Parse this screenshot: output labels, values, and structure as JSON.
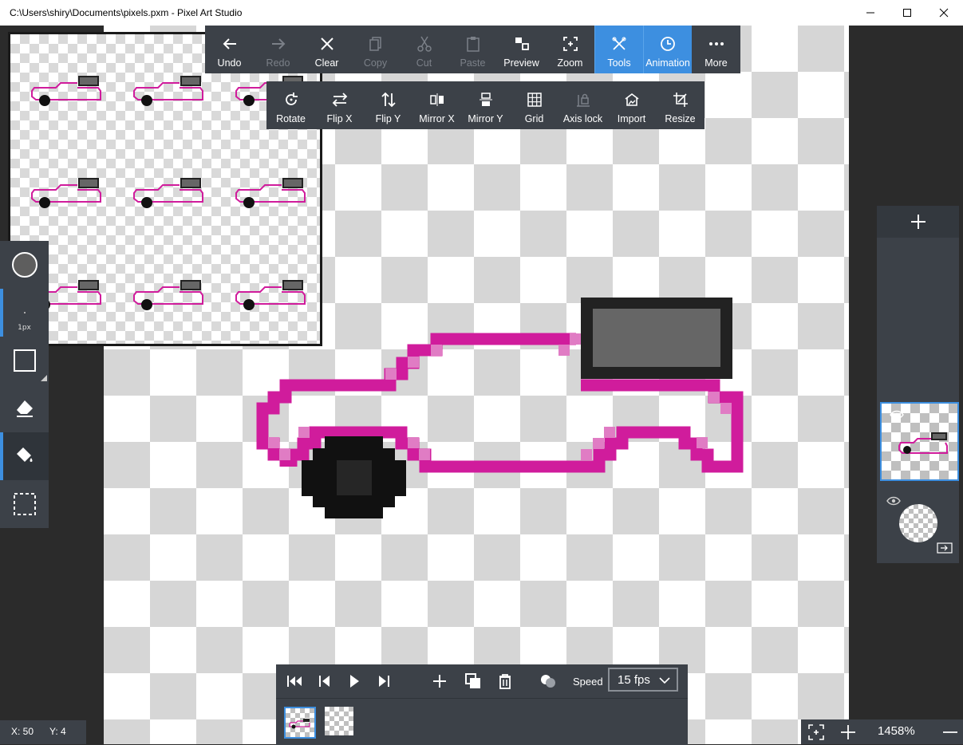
{
  "window": {
    "title": "C:\\Users\\shiry\\Documents\\pixels.pxm - Pixel Art Studio"
  },
  "toolbar_main": [
    {
      "label": "Undo",
      "icon": "arrow-left-icon",
      "state": "enabled"
    },
    {
      "label": "Redo",
      "icon": "arrow-right-icon",
      "state": "disabled"
    },
    {
      "label": "Clear",
      "icon": "close-icon",
      "state": "enabled"
    },
    {
      "label": "Copy",
      "icon": "copy-icon",
      "state": "disabled"
    },
    {
      "label": "Cut",
      "icon": "scissors-icon",
      "state": "disabled"
    },
    {
      "label": "Paste",
      "icon": "paste-icon",
      "state": "disabled"
    },
    {
      "label": "Preview",
      "icon": "preview-icon",
      "state": "enabled"
    },
    {
      "label": "Zoom",
      "icon": "zoom-icon",
      "state": "enabled"
    },
    {
      "label": "Tools",
      "icon": "tools-icon",
      "state": "active"
    },
    {
      "label": "Animation",
      "icon": "clock-icon",
      "state": "active"
    },
    {
      "label": "More",
      "icon": "more-icon",
      "state": "enabled"
    }
  ],
  "toolbar_tools": [
    {
      "label": "Rotate",
      "icon": "rotate-icon"
    },
    {
      "label": "Flip X",
      "icon": "flip-x-icon"
    },
    {
      "label": "Flip Y",
      "icon": "flip-y-icon"
    },
    {
      "label": "Mirror X",
      "icon": "mirror-x-icon"
    },
    {
      "label": "Mirror Y",
      "icon": "mirror-y-icon"
    },
    {
      "label": "Grid",
      "icon": "grid-icon"
    },
    {
      "label": "Axis lock",
      "icon": "axis-lock-icon"
    },
    {
      "label": "Import",
      "icon": "import-icon"
    },
    {
      "label": "Resize",
      "icon": "resize-icon"
    }
  ],
  "left_tools": {
    "brush_size": "1px"
  },
  "animation": {
    "speed_label": "Speed",
    "fps": "15 fps"
  },
  "status": {
    "x": "X: 50",
    "y": "Y: 4"
  },
  "zoom": {
    "level": "1458%"
  },
  "colors": {
    "accent": "#3d8fe0",
    "magenta": "#d01c9c",
    "light_magenta": "#e07cc4",
    "dark": "#222222",
    "gray": "#666666"
  }
}
